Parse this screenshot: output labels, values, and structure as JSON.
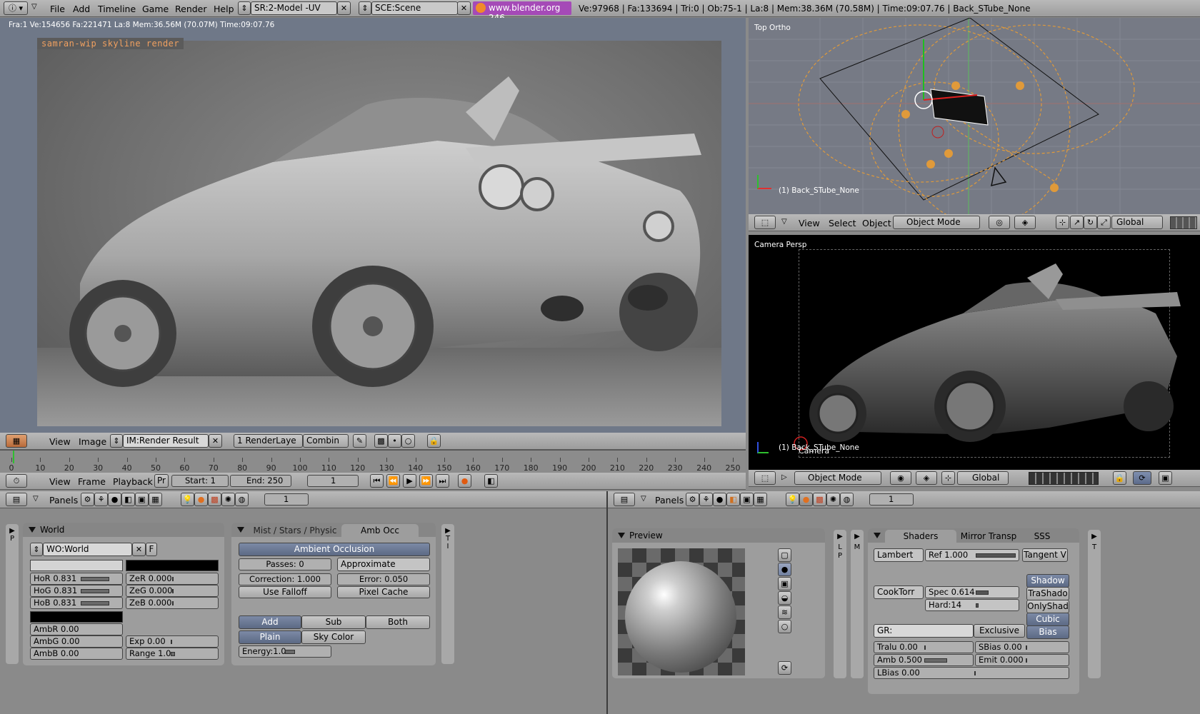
{
  "topbar": {
    "menus": [
      "File",
      "Add",
      "Timeline",
      "Game",
      "Render",
      "Help"
    ],
    "screen": "SR:2-Model -UV",
    "scene": "SCE:Scene",
    "url": "www.blender.org 246",
    "stats": "Ve:97968 | Fa:133694 | Tri:0 | Ob:75-1 | La:8  | Mem:38.36M (70.58M) | Time:09:07.76 | Back_STube_None"
  },
  "render_view": {
    "info": "Fra:1  Ve:154656 Fa:221471 La:8 Mem:36.56M (70.07M) Time:09:07.76",
    "caption": "samran-wip skyline render",
    "menu_view": "View",
    "menu_image": "Image",
    "image_name": "IM:Render Result",
    "render_layer": "1 RenderLaye",
    "pass": "Combin"
  },
  "timeline": {
    "ticks": [
      "0",
      "10",
      "20",
      "30",
      "40",
      "50",
      "60",
      "70",
      "80",
      "90",
      "100",
      "110",
      "120",
      "130",
      "140",
      "150",
      "160",
      "170",
      "180",
      "190",
      "200",
      "210",
      "220",
      "230",
      "240",
      "250"
    ],
    "menus": [
      "View",
      "Frame",
      "Playback"
    ],
    "pr": "Pr",
    "start": "Start: 1",
    "end": "End: 250",
    "current": "1"
  },
  "top_view": {
    "label": "Top Ortho",
    "object_label": "(1) Back_STube_None",
    "menus": [
      "View",
      "Select",
      "Object"
    ],
    "mode": "Object Mode",
    "orientation": "Global"
  },
  "camera_view": {
    "label": "Camera Persp",
    "camera_name": "Camera",
    "object_label": "(1) Back_STube_None",
    "mode": "Object Mode",
    "orientation": "Global"
  },
  "buttons_left": {
    "panels_label": "Panels",
    "frame": "1",
    "world_panel": {
      "title": "World",
      "name": "WO:World",
      "fake": "F",
      "hor": "HoR 0.831",
      "hog": "HoG 0.831",
      "hob": "HoB 0.831",
      "zer": "ZeR 0.000",
      "zeg": "ZeG 0.000",
      "zeb": "ZeB 0.000",
      "ambr": "AmbR 0.00",
      "ambg": "AmbG 0.00",
      "ambb": "AmbB 0.00",
      "exp": "Exp 0.00",
      "range": "Range 1.0",
      "side_p": "P",
      "ambr_pct": 0.0,
      "hor_pct": 0.83
    },
    "ao_panel": {
      "tab1": "Mist / Stars / Physic",
      "tab2": "Amb Occ",
      "toggle": "Ambient Occlusion",
      "passes": "Passes: 0",
      "method": "Approximate",
      "correction": "Correction: 1.000",
      "error": "Error: 0.050",
      "use_falloff": "Use Falloff",
      "pixel_cache": "Pixel Cache",
      "add": "Add",
      "sub": "Sub",
      "both": "Both",
      "plain": "Plain",
      "sky_color": "Sky Color",
      "energy": "Energy:1.0",
      "side_t": "T",
      "side_i": "I"
    }
  },
  "buttons_right": {
    "panels_label": "Panels",
    "frame": "1",
    "preview_title": "Preview",
    "side_lp": "L\nP",
    "side_m": "M",
    "side_t": "T",
    "shaders": {
      "tab1": "Shaders",
      "tab2": "Mirror Transp",
      "tab3": "SSS",
      "diffuse": "Lambert",
      "ref": "Ref   1.000",
      "tangent": "Tangent V",
      "specular": "CookTorr",
      "spec": "Spec 0.614",
      "hard": "Hard:14",
      "shadow": "Shadow",
      "trashado": "TraShado",
      "onlyshad": "OnlyShad",
      "cubic": "Cubic",
      "bias": "Bias",
      "gr": "GR:",
      "exclusive": "Exclusive",
      "tralu": "Tralu 0.00",
      "sbias": "SBias 0.00",
      "amb": "Amb 0.500",
      "emit": "Emit 0.000",
      "lbias": "LBias 0.00"
    }
  }
}
